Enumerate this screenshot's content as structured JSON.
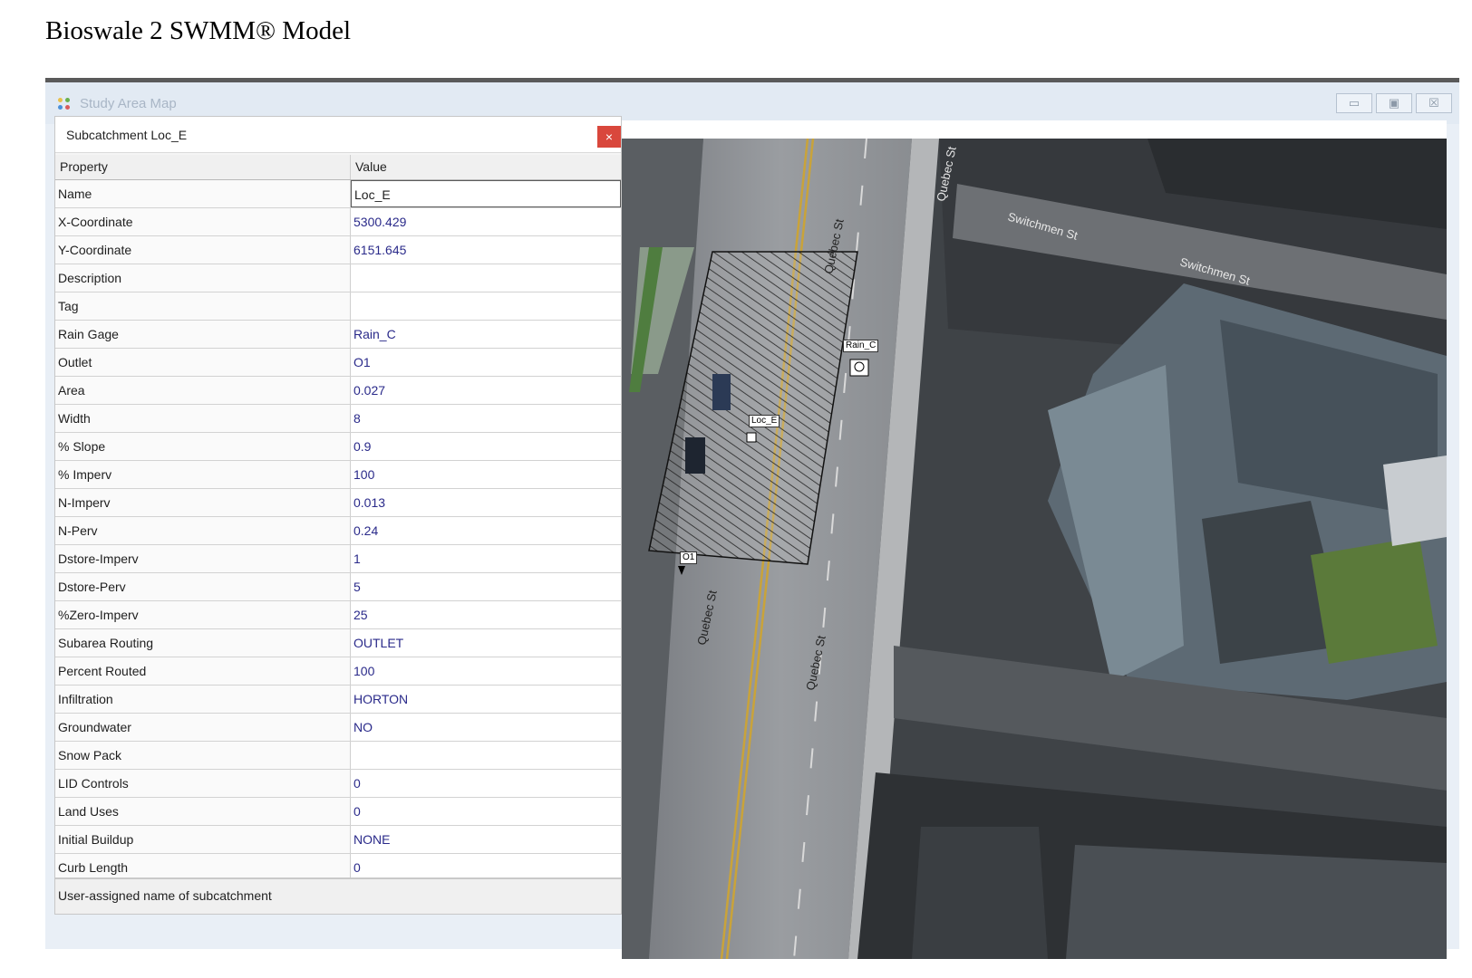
{
  "page": {
    "heading": "Bioswale 2 SWMM® Model"
  },
  "window": {
    "title": "Study Area Map",
    "controls": {
      "minimize": "▭",
      "maximize": "▣",
      "close": "☒"
    }
  },
  "dialog": {
    "title": "Subcatchment Loc_E",
    "close_glyph": "×",
    "columns": {
      "property": "Property",
      "value": "Value"
    },
    "rows": [
      {
        "property": "Name",
        "value": "Loc_E"
      },
      {
        "property": "X-Coordinate",
        "value": "5300.429"
      },
      {
        "property": "Y-Coordinate",
        "value": "6151.645"
      },
      {
        "property": "Description",
        "value": ""
      },
      {
        "property": "Tag",
        "value": ""
      },
      {
        "property": "Rain Gage",
        "value": "Rain_C"
      },
      {
        "property": "Outlet",
        "value": "O1"
      },
      {
        "property": "Area",
        "value": "0.027"
      },
      {
        "property": "Width",
        "value": "8"
      },
      {
        "property": "% Slope",
        "value": "0.9"
      },
      {
        "property": "% Imperv",
        "value": "100"
      },
      {
        "property": "N-Imperv",
        "value": "0.013"
      },
      {
        "property": "N-Perv",
        "value": "0.24"
      },
      {
        "property": "Dstore-Imperv",
        "value": "1"
      },
      {
        "property": "Dstore-Perv",
        "value": "5"
      },
      {
        "property": "%Zero-Imperv",
        "value": "25"
      },
      {
        "property": "Subarea Routing",
        "value": "OUTLET"
      },
      {
        "property": "Percent Routed",
        "value": "100"
      },
      {
        "property": "Infiltration",
        "value": "HORTON"
      },
      {
        "property": "Groundwater",
        "value": "NO"
      },
      {
        "property": "Snow Pack",
        "value": ""
      },
      {
        "property": "LID Controls",
        "value": "0"
      },
      {
        "property": "Land Uses",
        "value": "0"
      },
      {
        "property": "Initial Buildup",
        "value": "NONE"
      },
      {
        "property": "Curb Length",
        "value": "0"
      }
    ],
    "status": "User-assigned name of subcatchment"
  },
  "map": {
    "street_labels": [
      "Quebec St",
      "Switchmen St",
      "Switchmen St",
      "Quebec St",
      "Quebec St",
      "Quebec St"
    ],
    "markers": {
      "rain_gage": "Rain_C",
      "subcatchment": "Loc_E",
      "outlet": "O1"
    }
  }
}
